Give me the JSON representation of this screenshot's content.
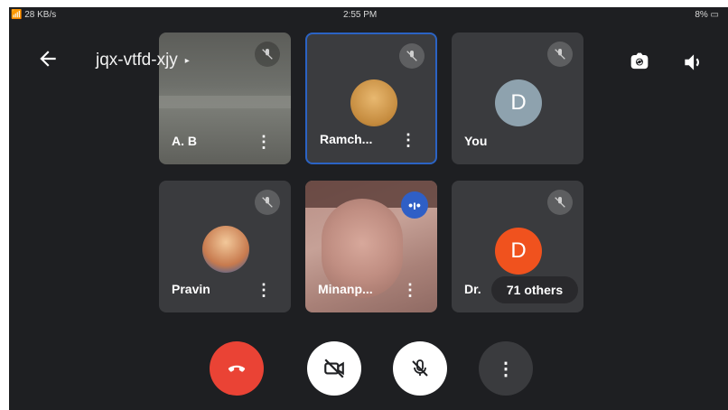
{
  "status_bar": {
    "network": "📶 28 KB/s",
    "time": "2:55 PM",
    "battery": "8% ▭"
  },
  "header": {
    "meeting_code": "jqx-vtfd-xjy",
    "caret": "▸"
  },
  "participants": [
    {
      "name": "A. B",
      "muted": true
    },
    {
      "name": "Ramch...",
      "muted": true,
      "active_border": "#2b63c4"
    },
    {
      "name": "You",
      "initial": "D",
      "muted": true
    },
    {
      "name": "Pravin",
      "muted": true
    },
    {
      "name": "Minanp...",
      "speaking": true
    },
    {
      "name": "Dr.",
      "initial": "D",
      "muted": true,
      "avatar_color": "#f0521e"
    }
  ],
  "others_badge": "71 others",
  "more_glyph": "⋮",
  "controls": {
    "end_call_color": "#ea4335",
    "more_glyph": "⋮"
  },
  "icons": {
    "back": "arrow-left-icon",
    "switch_camera": "camera-switch-icon",
    "speaker": "speaker-icon",
    "mic_off": "mic-off-icon",
    "camera_off": "camera-off-icon",
    "end_call": "phone-hangup-icon"
  }
}
